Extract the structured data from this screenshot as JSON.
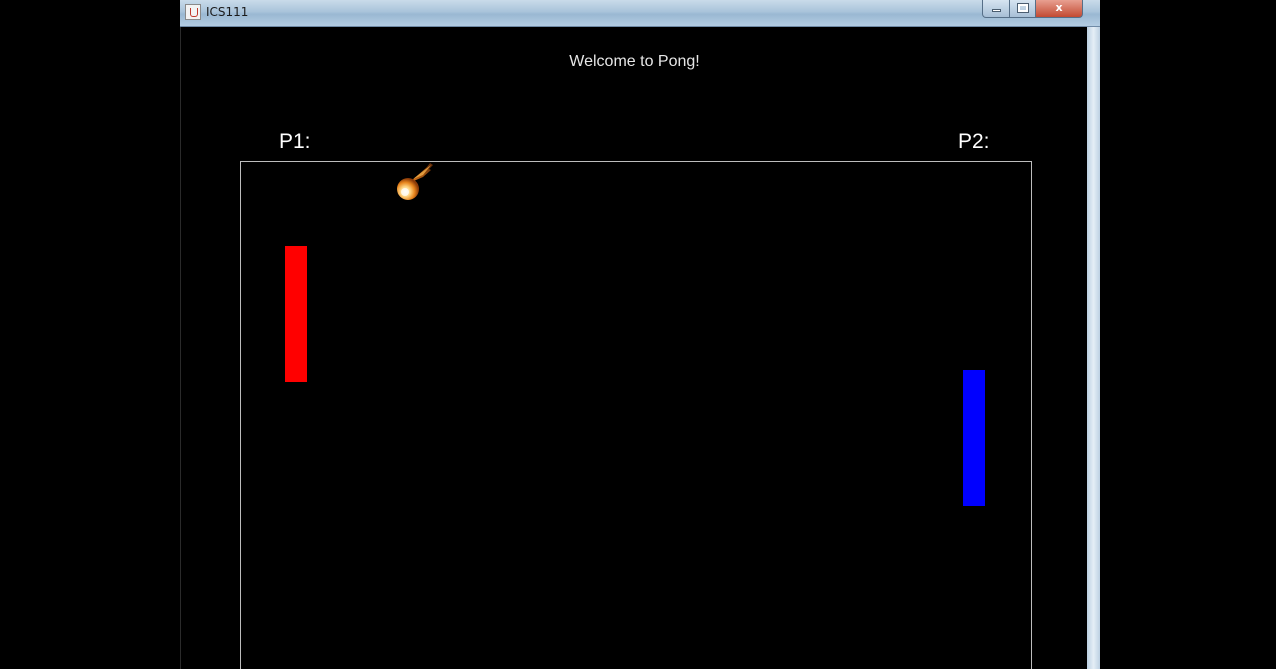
{
  "window": {
    "title": "ICS111",
    "controls": {
      "minimize_icon": "minimize-icon",
      "maximize_icon": "maximize-icon",
      "close_label": "x"
    }
  },
  "game": {
    "welcome_text": "Welcome to Pong!",
    "players": {
      "p1": {
        "label": "P1:",
        "paddle_color": "#ff0000"
      },
      "p2": {
        "label": "P2:",
        "paddle_color": "#0000ff"
      }
    },
    "ball_icon": "fireball-icon"
  }
}
